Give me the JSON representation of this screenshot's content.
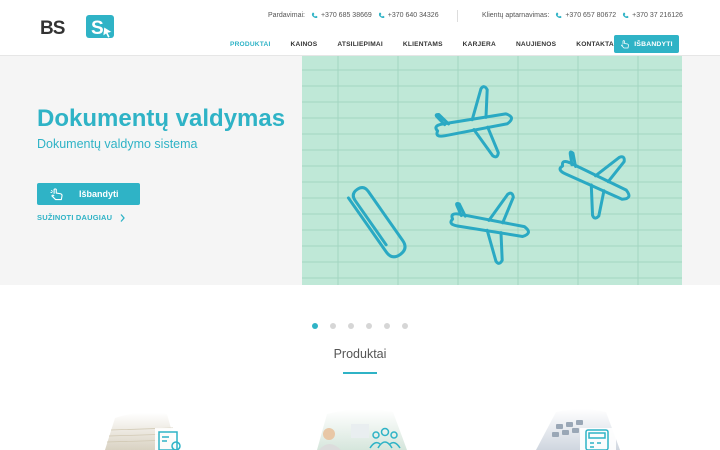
{
  "brand": {
    "logo_text": "BSS"
  },
  "header": {
    "sales": {
      "label": "Pardavimai:",
      "phones": [
        "+370 685 38669",
        "+370 640 34326"
      ]
    },
    "service": {
      "label": "Klientų aptarnavimas:",
      "phones": [
        "+370 657 80672",
        "+370 37 216126"
      ]
    }
  },
  "nav": {
    "items": [
      {
        "label": "PRODUKTAI",
        "active": true
      },
      {
        "label": "KAINOS",
        "active": false
      },
      {
        "label": "ATSILIEPIMAI",
        "active": false
      },
      {
        "label": "KLIENTAMS",
        "active": false
      },
      {
        "label": "KARJERA",
        "active": false
      },
      {
        "label": "NAUJIENOS",
        "active": false
      },
      {
        "label": "KONTAKTAI",
        "active": false
      }
    ],
    "try_button": "IŠBANDYTI",
    "try_icon": "hand-pointer-icon"
  },
  "hero": {
    "title": "Dokumentų valdymas",
    "subtitle": "Dokumentų valdymo sistema",
    "cta_label": "Išbandyti",
    "cta_icon": "hand-pointer-icon",
    "more_label": "SUŽINOTI DAUGIAU",
    "image": "paper-clip-airplanes-on-green-grid"
  },
  "slider": {
    "count": 6,
    "active_index": 0
  },
  "products": {
    "title": "Produktai",
    "items": [
      {
        "image": "documents-stack",
        "icon": "document-form-icon"
      },
      {
        "image": "business-people",
        "icon": "people-group-icon"
      },
      {
        "image": "calculator",
        "icon": "calculator-icon"
      }
    ]
  },
  "colors": {
    "accent": "#2fb3c6",
    "hero_bg": "#f5f5f5",
    "grid_green": "#bfe8d7"
  }
}
